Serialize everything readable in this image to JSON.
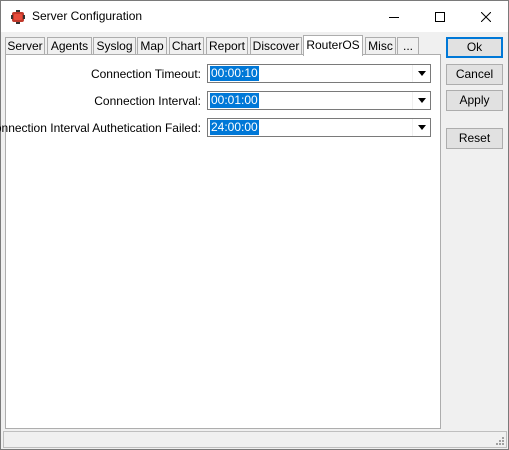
{
  "window": {
    "title": "Server Configuration"
  },
  "title_buttons": {
    "minimize": "minimize-icon",
    "maximize": "maximize-icon",
    "close": "close-icon"
  },
  "tabs": [
    {
      "label": "Server"
    },
    {
      "label": "Agents"
    },
    {
      "label": "Syslog"
    },
    {
      "label": "Map"
    },
    {
      "label": "Chart"
    },
    {
      "label": "Report"
    },
    {
      "label": "Discover"
    },
    {
      "label": "RouterOS",
      "active": true
    },
    {
      "label": "Misc"
    },
    {
      "label": "..."
    }
  ],
  "fields": [
    {
      "label": "Connection Timeout:",
      "value": "00:00:10"
    },
    {
      "label": "Connection Interval:",
      "value": "00:01:00"
    },
    {
      "label": "Connection Interval Authetication Failed:",
      "value": "24:00:00"
    }
  ],
  "buttons": {
    "ok": "Ok",
    "cancel": "Cancel",
    "apply": "Apply",
    "reset": "Reset"
  },
  "colors": {
    "selection": "#0078d7",
    "window_bg": "#f0f0f0",
    "app_icon": "#c0392b"
  }
}
